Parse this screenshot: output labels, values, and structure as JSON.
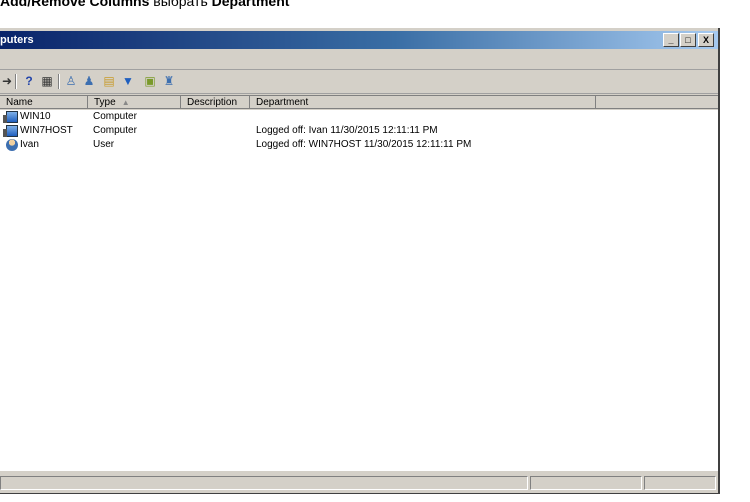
{
  "caption": {
    "bold1": "Add/Remove Columns",
    "plain": "выбрать",
    "bold2": "Department"
  },
  "window": {
    "title": "puters",
    "buttons": {
      "min": "_",
      "max": "□",
      "close": "X"
    }
  },
  "toolbar": {
    "icons": [
      "back-icon",
      "help-icon",
      "view-icon",
      "user-icon",
      "users-icon",
      "folder-icon",
      "filter-icon",
      "report-icon",
      "group-icon"
    ]
  },
  "columns": [
    "Name",
    "Type",
    "Description",
    "Department"
  ],
  "rows": [
    {
      "name": "WIN10",
      "type": "Computer",
      "description": "",
      "department": "",
      "icon": "computer-icon"
    },
    {
      "name": "WIN7HOST",
      "type": "Computer",
      "description": "",
      "department": "Logged off: Ivan 11/30/2015 12:11:11 PM",
      "icon": "computer-icon"
    },
    {
      "name": "Ivan",
      "type": "User",
      "description": "",
      "department": "Logged off: WIN7HOST 11/30/2015 12:11:11 PM",
      "icon": "user-icon"
    }
  ]
}
